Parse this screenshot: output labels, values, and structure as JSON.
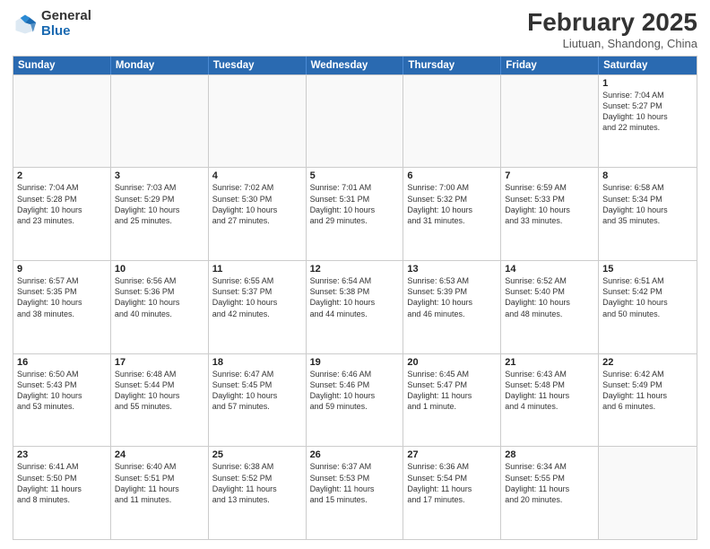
{
  "header": {
    "logo_general": "General",
    "logo_blue": "Blue",
    "month_title": "February 2025",
    "location": "Liutuan, Shandong, China"
  },
  "weekdays": [
    "Sunday",
    "Monday",
    "Tuesday",
    "Wednesday",
    "Thursday",
    "Friday",
    "Saturday"
  ],
  "weeks": [
    [
      {
        "day": "",
        "info": ""
      },
      {
        "day": "",
        "info": ""
      },
      {
        "day": "",
        "info": ""
      },
      {
        "day": "",
        "info": ""
      },
      {
        "day": "",
        "info": ""
      },
      {
        "day": "",
        "info": ""
      },
      {
        "day": "1",
        "info": "Sunrise: 7:04 AM\nSunset: 5:27 PM\nDaylight: 10 hours\nand 22 minutes."
      }
    ],
    [
      {
        "day": "2",
        "info": "Sunrise: 7:04 AM\nSunset: 5:28 PM\nDaylight: 10 hours\nand 23 minutes."
      },
      {
        "day": "3",
        "info": "Sunrise: 7:03 AM\nSunset: 5:29 PM\nDaylight: 10 hours\nand 25 minutes."
      },
      {
        "day": "4",
        "info": "Sunrise: 7:02 AM\nSunset: 5:30 PM\nDaylight: 10 hours\nand 27 minutes."
      },
      {
        "day": "5",
        "info": "Sunrise: 7:01 AM\nSunset: 5:31 PM\nDaylight: 10 hours\nand 29 minutes."
      },
      {
        "day": "6",
        "info": "Sunrise: 7:00 AM\nSunset: 5:32 PM\nDaylight: 10 hours\nand 31 minutes."
      },
      {
        "day": "7",
        "info": "Sunrise: 6:59 AM\nSunset: 5:33 PM\nDaylight: 10 hours\nand 33 minutes."
      },
      {
        "day": "8",
        "info": "Sunrise: 6:58 AM\nSunset: 5:34 PM\nDaylight: 10 hours\nand 35 minutes."
      }
    ],
    [
      {
        "day": "9",
        "info": "Sunrise: 6:57 AM\nSunset: 5:35 PM\nDaylight: 10 hours\nand 38 minutes."
      },
      {
        "day": "10",
        "info": "Sunrise: 6:56 AM\nSunset: 5:36 PM\nDaylight: 10 hours\nand 40 minutes."
      },
      {
        "day": "11",
        "info": "Sunrise: 6:55 AM\nSunset: 5:37 PM\nDaylight: 10 hours\nand 42 minutes."
      },
      {
        "day": "12",
        "info": "Sunrise: 6:54 AM\nSunset: 5:38 PM\nDaylight: 10 hours\nand 44 minutes."
      },
      {
        "day": "13",
        "info": "Sunrise: 6:53 AM\nSunset: 5:39 PM\nDaylight: 10 hours\nand 46 minutes."
      },
      {
        "day": "14",
        "info": "Sunrise: 6:52 AM\nSunset: 5:40 PM\nDaylight: 10 hours\nand 48 minutes."
      },
      {
        "day": "15",
        "info": "Sunrise: 6:51 AM\nSunset: 5:42 PM\nDaylight: 10 hours\nand 50 minutes."
      }
    ],
    [
      {
        "day": "16",
        "info": "Sunrise: 6:50 AM\nSunset: 5:43 PM\nDaylight: 10 hours\nand 53 minutes."
      },
      {
        "day": "17",
        "info": "Sunrise: 6:48 AM\nSunset: 5:44 PM\nDaylight: 10 hours\nand 55 minutes."
      },
      {
        "day": "18",
        "info": "Sunrise: 6:47 AM\nSunset: 5:45 PM\nDaylight: 10 hours\nand 57 minutes."
      },
      {
        "day": "19",
        "info": "Sunrise: 6:46 AM\nSunset: 5:46 PM\nDaylight: 10 hours\nand 59 minutes."
      },
      {
        "day": "20",
        "info": "Sunrise: 6:45 AM\nSunset: 5:47 PM\nDaylight: 11 hours\nand 1 minute."
      },
      {
        "day": "21",
        "info": "Sunrise: 6:43 AM\nSunset: 5:48 PM\nDaylight: 11 hours\nand 4 minutes."
      },
      {
        "day": "22",
        "info": "Sunrise: 6:42 AM\nSunset: 5:49 PM\nDaylight: 11 hours\nand 6 minutes."
      }
    ],
    [
      {
        "day": "23",
        "info": "Sunrise: 6:41 AM\nSunset: 5:50 PM\nDaylight: 11 hours\nand 8 minutes."
      },
      {
        "day": "24",
        "info": "Sunrise: 6:40 AM\nSunset: 5:51 PM\nDaylight: 11 hours\nand 11 minutes."
      },
      {
        "day": "25",
        "info": "Sunrise: 6:38 AM\nSunset: 5:52 PM\nDaylight: 11 hours\nand 13 minutes."
      },
      {
        "day": "26",
        "info": "Sunrise: 6:37 AM\nSunset: 5:53 PM\nDaylight: 11 hours\nand 15 minutes."
      },
      {
        "day": "27",
        "info": "Sunrise: 6:36 AM\nSunset: 5:54 PM\nDaylight: 11 hours\nand 17 minutes."
      },
      {
        "day": "28",
        "info": "Sunrise: 6:34 AM\nSunset: 5:55 PM\nDaylight: 11 hours\nand 20 minutes."
      },
      {
        "day": "",
        "info": ""
      }
    ]
  ]
}
